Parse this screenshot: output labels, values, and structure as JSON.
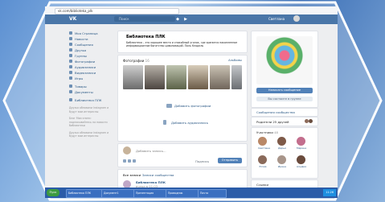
{
  "browser": {
    "url": "vk.com/biblioteka_plk"
  },
  "header": {
    "logo": "VK",
    "search_placeholder": "Поиск",
    "user_name": "Светлана"
  },
  "left_menu": {
    "items": [
      {
        "label": "Моя Страница"
      },
      {
        "label": "Новости"
      },
      {
        "label": "Сообщения"
      },
      {
        "label": "Друзья"
      },
      {
        "label": "Группы"
      },
      {
        "label": "Фотографии"
      },
      {
        "label": "Аудиозаписи"
      },
      {
        "label": "Видеозаписи"
      },
      {
        "label": "Игры"
      }
    ],
    "items2": [
      {
        "label": "Товары"
      },
      {
        "label": "Документы"
      }
    ],
    "items3": [
      {
        "label": "Библиотека ПЛК"
      }
    ],
    "footer1": "Друзья обновили Instagram и будут вам интересны",
    "footer2": "Блог Мои книги: подписывайтесь на новости библиотеки",
    "footer3": "Друзья обновили Instagram и будут вам интересны"
  },
  "group": {
    "title": "Библиотека ПЛК",
    "description": "Библиотека – это хорошее место и спокойный уголок, где хранится накопленное информационное богатство цивилизаций. Поль Клодель"
  },
  "photos": {
    "title": "Фотографии",
    "count": "16",
    "all_label": "Альбомы"
  },
  "actions": {
    "add_photos": "Добавить фотографии",
    "add_audio": "Добавить аудиозапись"
  },
  "post": {
    "placeholder": "Добавить запись...",
    "signature_label": "Подпись",
    "submit_label": "Отправить"
  },
  "wall_tabs": {
    "all": "Все записи",
    "community": "Записи сообщества"
  },
  "wall_post": {
    "author": "Библиотека ПЛК",
    "date": "вчера в 11:03"
  },
  "sidebar": {
    "message_button": "Написать сообщение",
    "subscribe_button": "Вы состоите в группе",
    "community_messages": "Сообщения сообщества",
    "reminders": "Родители 25 друзей",
    "members_title": "Участники",
    "members_count": "48",
    "members": [
      {
        "name": "Светлана",
        "color": "#b98867"
      },
      {
        "name": "Дарья",
        "color": "#7e5a48"
      },
      {
        "name": "Марина",
        "color": "#c36e8d"
      },
      {
        "name": "Юлия",
        "color": "#8a6a5a"
      },
      {
        "name": "Ирина",
        "color": "#a8958a"
      },
      {
        "name": "Альфия",
        "color": "#6a4b3d"
      }
    ],
    "links_title": "Ссылки"
  },
  "taskbar": {
    "start": "Пуск",
    "items": [
      "Библиотека ПЛК",
      "Документ1",
      "Презентация",
      "Проводник",
      "Почта"
    ],
    "clock": "11:26"
  }
}
